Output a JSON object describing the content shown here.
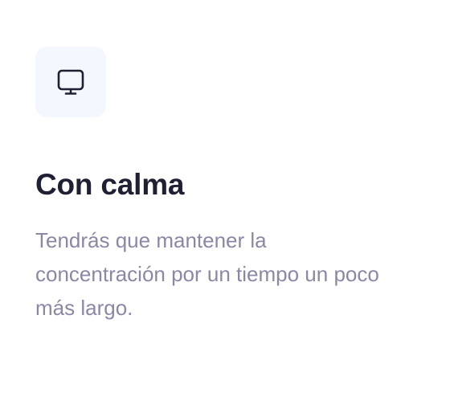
{
  "card": {
    "icon": "monitor-icon",
    "title": "Con calma",
    "description": "Tendrás que mantener la concentración por un tiempo un poco más largo."
  },
  "colors": {
    "icon_tile_bg": "#f4f7fd",
    "icon_stroke": "#1f2033",
    "title": "#1f2033",
    "description": "#8a88a5"
  }
}
